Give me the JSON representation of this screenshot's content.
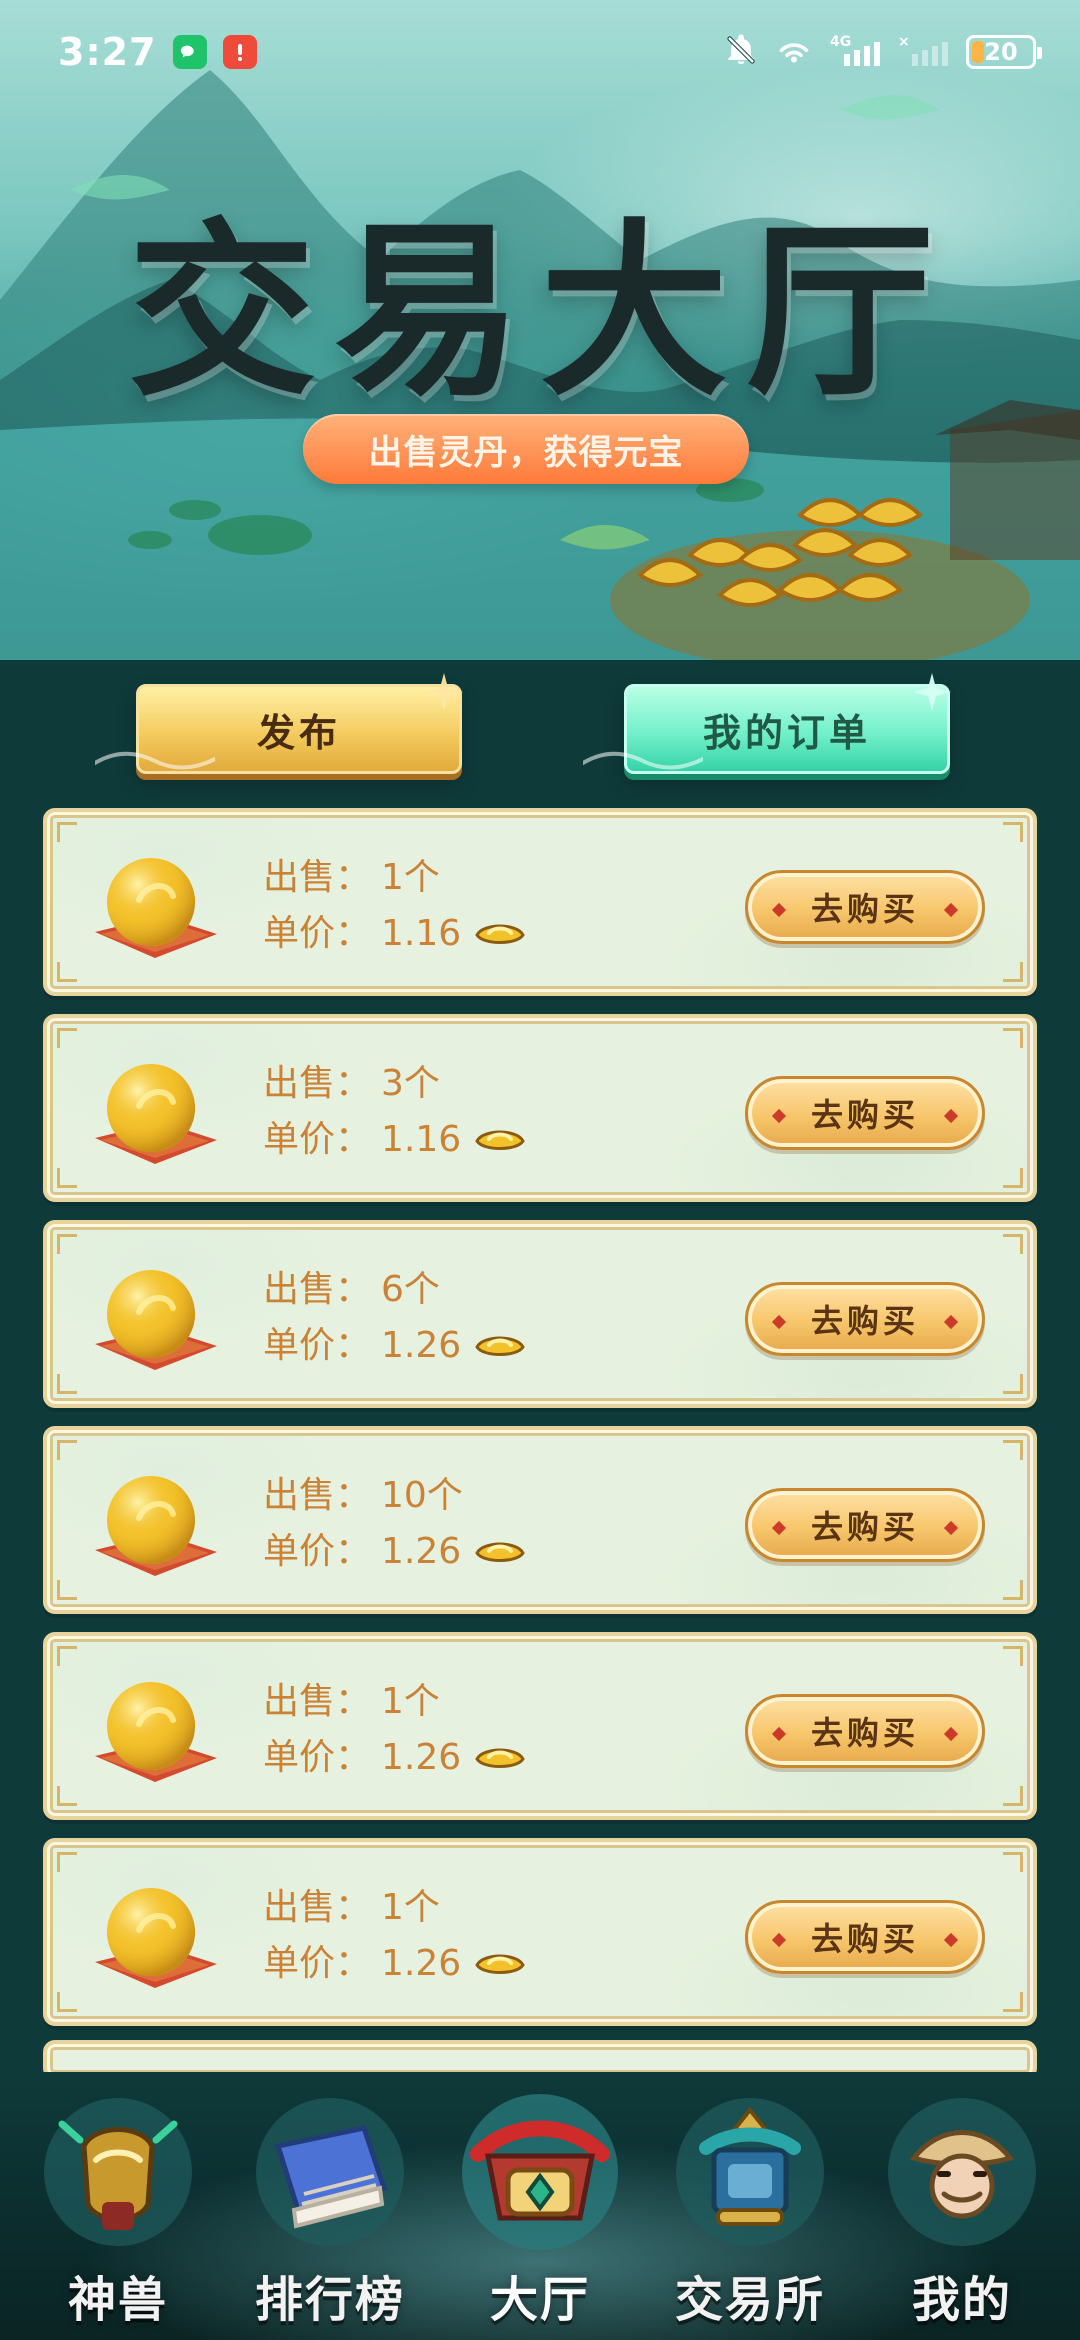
{
  "status_bar": {
    "time": "3:27",
    "battery": "20",
    "icons": {
      "wechat": "wechat-icon",
      "alert": "notification-badge-icon",
      "mute": "bell-muted-icon",
      "wifi": "wifi-icon",
      "signal_4g": "signal-4g-icon",
      "signal2": "signal-no-service-icon"
    }
  },
  "hero": {
    "title": "交易大厅",
    "subtitle": "出售灵丹，获得元宝"
  },
  "top_actions": {
    "publish_label": "发布",
    "orders_label": "我的订单"
  },
  "listings": [
    {
      "sell_label": "出售：",
      "quantity": "1个",
      "price_label": "单价：",
      "price": "1.16",
      "buy_label": "去购买"
    },
    {
      "sell_label": "出售：",
      "quantity": "3个",
      "price_label": "单价：",
      "price": "1.16",
      "buy_label": "去购买"
    },
    {
      "sell_label": "出售：",
      "quantity": "6个",
      "price_label": "单价：",
      "price": "1.26",
      "buy_label": "去购买"
    },
    {
      "sell_label": "出售：",
      "quantity": "10个",
      "price_label": "单价：",
      "price": "1.26",
      "buy_label": "去购买"
    },
    {
      "sell_label": "出售：",
      "quantity": "1个",
      "price_label": "单价：",
      "price": "1.26",
      "buy_label": "去购买"
    },
    {
      "sell_label": "出售：",
      "quantity": "1个",
      "price_label": "单价：",
      "price": "1.26",
      "buy_label": "去购买"
    }
  ],
  "bottom_nav": {
    "items": [
      {
        "label": "神兽",
        "icon": "beast-icon"
      },
      {
        "label": "排行榜",
        "icon": "leaderboard-book-icon"
      },
      {
        "label": "大厅",
        "icon": "hall-pavilion-icon",
        "active": true
      },
      {
        "label": "交易所",
        "icon": "exchange-pagoda-icon"
      },
      {
        "label": "我的",
        "icon": "profile-character-icon"
      }
    ]
  },
  "colors": {
    "accent_orange": "#ff7a3a",
    "gold": "#f3c85a",
    "mint": "#36d3a8",
    "dark_teal": "#0f3a3a",
    "card_bg": "#e6f2df",
    "price_text": "#c98236"
  }
}
